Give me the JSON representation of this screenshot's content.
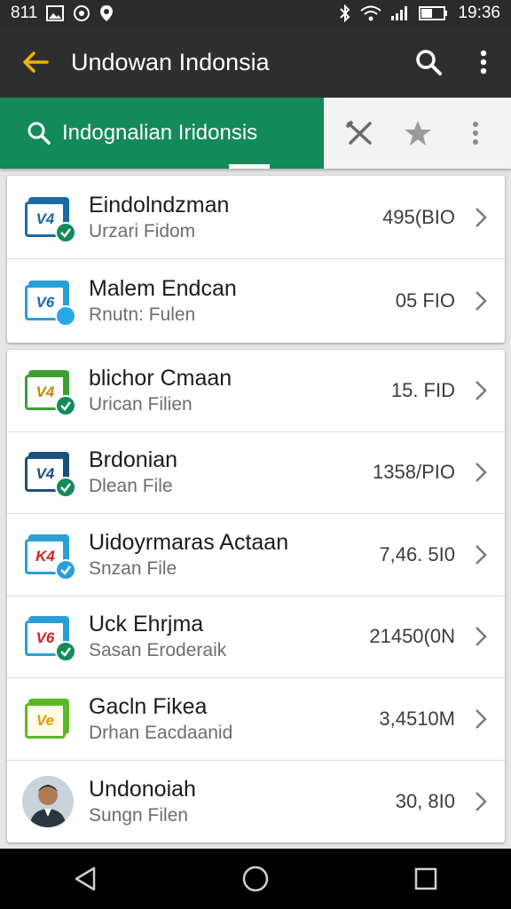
{
  "status_bar": {
    "time": "19:36",
    "left_text": "811",
    "battery_icon": "battery-icon",
    "wifi_icon": "wifi-icon",
    "bluetooth_icon": "bluetooth-icon"
  },
  "app_bar": {
    "title": "Undowan Indonsia",
    "back_icon": "arrow-back-icon",
    "search_icon": "search-icon",
    "menu_icon": "more-vert-icon"
  },
  "search": {
    "label": "Indognalian Iridonsis"
  },
  "colors": {
    "accent_green": "#138a5a",
    "back_arrow": "#f0b400",
    "app_bar": "#2e2e2e"
  },
  "card1": [
    {
      "name": "Eindolndzman",
      "sub": "Urzari Fidom",
      "size": "495(BIO",
      "icon_text": "V4",
      "icon_color": "#1a6aa8",
      "badge": "check",
      "badge_color": "#138a5a"
    },
    {
      "name": "Malem Endcan",
      "sub": "Rnutn: Fulen",
      "size": "05 FIO",
      "icon_text": "V6",
      "icon_color": "#2a9fd6",
      "badge": "dot",
      "badge_color": "#29a8e6"
    }
  ],
  "card2": [
    {
      "name": "blichor Cmaan",
      "sub": "Urican Filien",
      "size": "15. FID",
      "icon_text": "V4",
      "icon_color": "#3aa02e",
      "badge": "check",
      "badge_color": "#138a5a",
      "text_color": "#c08a00"
    },
    {
      "name": "Brdonian",
      "sub": "Dlean File",
      "size": "1358/PIO",
      "icon_text": "V4",
      "icon_color": "#1a4f7a",
      "badge": "check",
      "badge_color": "#138a5a",
      "text_color": "#1a4f7a"
    },
    {
      "name": "Uidoyrmaras Actaan",
      "sub": "Snzan File",
      "size": "7,46. 5I0",
      "icon_text": "K4",
      "icon_color": "#2a9fd6",
      "badge": "check",
      "badge_color": "#2a9fd6",
      "text_color": "#d32020"
    },
    {
      "name": "Uck Ehrjma",
      "sub": "Sasan Eroderaik",
      "size": "21450(0N",
      "icon_text": "V6",
      "icon_color": "#2a9fd6",
      "badge": "check",
      "badge_color": "#138a5a",
      "text_color": "#d32020"
    },
    {
      "name": "Gacln Fikea",
      "sub": "Drhan Eacdaanid",
      "size": "3,4510M",
      "icon_text": "Ve",
      "icon_color": "#5cb82a",
      "badge": "none",
      "badge_color": "",
      "text_color": "#d8a000"
    },
    {
      "name": "Undonoiah",
      "sub": "Sungn Filen",
      "size": "30, 8I0",
      "avatar": true
    }
  ],
  "nav": {
    "back": "nav-back-icon",
    "home": "nav-home-icon",
    "recents": "nav-recents-icon"
  }
}
